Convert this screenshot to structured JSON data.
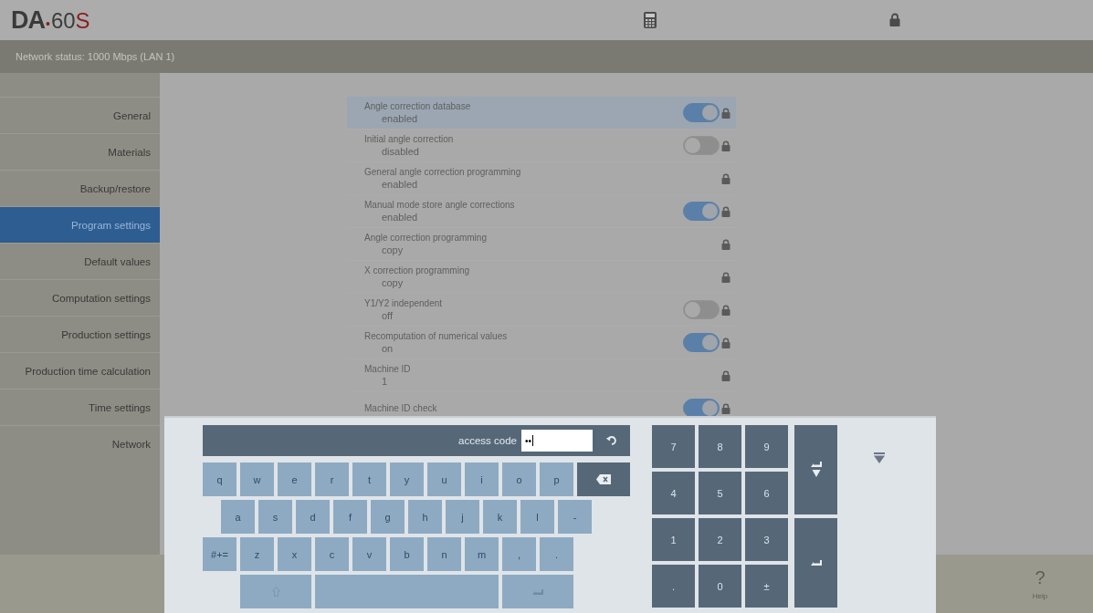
{
  "logo": {
    "brand": "DA",
    "separator": "•",
    "model": "60",
    "suffix": "S"
  },
  "network_status": "Network status: 1000 Mbps (LAN 1)",
  "sidebar": {
    "items": [
      {
        "label": "General",
        "selected": false
      },
      {
        "label": "Materials",
        "selected": false
      },
      {
        "label": "Backup/restore",
        "selected": false
      },
      {
        "label": "Program settings",
        "selected": true
      },
      {
        "label": "Default values",
        "selected": false
      },
      {
        "label": "Computation settings",
        "selected": false
      },
      {
        "label": "Production settings",
        "selected": false
      },
      {
        "label": "Production time calculation",
        "selected": false
      },
      {
        "label": "Time settings",
        "selected": false
      },
      {
        "label": "Network",
        "selected": false
      }
    ]
  },
  "settings": [
    {
      "label": "Angle correction database",
      "value": "enabled",
      "kind": "toggle",
      "on": true,
      "selected": true
    },
    {
      "label": "Initial angle correction",
      "value": "disabled",
      "kind": "toggle",
      "on": false,
      "selected": false
    },
    {
      "label": "General angle correction programming",
      "value": "enabled",
      "kind": "locked",
      "selected": false
    },
    {
      "label": "Manual mode store angle corrections",
      "value": "enabled",
      "kind": "toggle",
      "on": true,
      "selected": false
    },
    {
      "label": "Angle correction programming",
      "value": "copy",
      "kind": "locked",
      "selected": false
    },
    {
      "label": "X correction programming",
      "value": "copy",
      "kind": "locked",
      "selected": false
    },
    {
      "label": "Y1/Y2 independent",
      "value": "off",
      "kind": "toggle",
      "on": false,
      "selected": false
    },
    {
      "label": "Recomputation of numerical values",
      "value": "on",
      "kind": "toggle",
      "on": true,
      "selected": false
    },
    {
      "label": "Machine ID",
      "value": "1",
      "kind": "locked",
      "selected": false
    },
    {
      "label": "Machine ID check",
      "kind": "toggle",
      "on": true,
      "selected": false
    }
  ],
  "keyboard": {
    "field_label": "access code",
    "field_value": "••",
    "rows": [
      [
        {
          "kind": "char",
          "label": "q"
        },
        {
          "kind": "char",
          "label": "w"
        },
        {
          "kind": "char",
          "label": "e"
        },
        {
          "kind": "char",
          "label": "r"
        },
        {
          "kind": "char",
          "label": "t"
        },
        {
          "kind": "char",
          "label": "y"
        },
        {
          "kind": "char",
          "label": "u"
        },
        {
          "kind": "char",
          "label": "i"
        },
        {
          "kind": "char",
          "label": "o"
        },
        {
          "kind": "char",
          "label": "p"
        },
        {
          "kind": "backspace"
        }
      ],
      [
        {
          "kind": "char",
          "label": "a"
        },
        {
          "kind": "char",
          "label": "s"
        },
        {
          "kind": "char",
          "label": "d"
        },
        {
          "kind": "char",
          "label": "f"
        },
        {
          "kind": "char",
          "label": "g"
        },
        {
          "kind": "char",
          "label": "h"
        },
        {
          "kind": "char",
          "label": "j"
        },
        {
          "kind": "char",
          "label": "k"
        },
        {
          "kind": "char",
          "label": "l"
        },
        {
          "kind": "char",
          "label": "-"
        }
      ],
      [
        {
          "kind": "char",
          "label": "#+="
        },
        {
          "kind": "char",
          "label": "z"
        },
        {
          "kind": "char",
          "label": "x"
        },
        {
          "kind": "char",
          "label": "c"
        },
        {
          "kind": "char",
          "label": "v"
        },
        {
          "kind": "char",
          "label": "b"
        },
        {
          "kind": "char",
          "label": "n"
        },
        {
          "kind": "char",
          "label": "m"
        },
        {
          "kind": "char",
          "label": ","
        },
        {
          "kind": "char",
          "label": "."
        }
      ],
      [
        {
          "kind": "shift"
        },
        {
          "kind": "space"
        },
        {
          "kind": "enter"
        }
      ]
    ],
    "numpad": [
      "7",
      "8",
      "9",
      "4",
      "5",
      "6",
      "1",
      "2",
      "3",
      ".",
      "0",
      "±"
    ]
  },
  "help": {
    "glyph": "?",
    "label": "Help"
  }
}
